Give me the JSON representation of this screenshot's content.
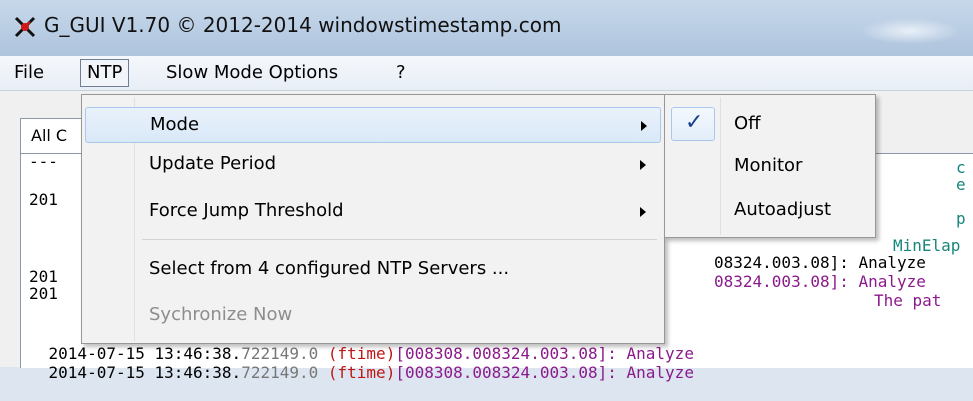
{
  "window": {
    "title": "G_GUI V1.70 © 2012-2014 windowstimestamp.com",
    "icon": "app-logo-icon"
  },
  "menubar": {
    "file": "File",
    "ntp": "NTP",
    "slow_mode": "Slow Mode Options",
    "help": "?"
  },
  "tabs": {
    "active": "All C"
  },
  "log": {
    "dashes": "---",
    "l1": "201",
    "l2": "201",
    "l3": "201",
    "r1": "c",
    "r2": "e",
    "r3": "p",
    "minelap": "MinElap",
    "analyze1": "08324.003.08]: Analyze",
    "analyze2": "08324.003.08]: Analyze",
    "pat": "The pat",
    "row_a_prefix": "2014-07-15 13:46:38.",
    "row_a_time": "722149.0",
    "row_a_ftime": "(ftime)",
    "row_a_rest": "[008308.008324.003.08]: Analyze",
    "row_b_prefix": "2014-07-15 13:46:38.",
    "row_b_time": "722149.0",
    "row_b_ftime": "(ftime)",
    "row_b_rest": "[008308.008324.003.08]: Analyze"
  },
  "ntp_menu": {
    "items": [
      {
        "label": "Mode",
        "submenu": true
      },
      {
        "label": "Update Period",
        "submenu": true
      },
      {
        "label": "Force Jump Threshold",
        "submenu": true
      },
      {
        "label": "Select from 4 configured NTP Servers ...",
        "submenu": false
      },
      {
        "label": "Sychronize Now",
        "submenu": false,
        "disabled": true
      }
    ]
  },
  "mode_submenu": {
    "check_glyph": "✓",
    "items": [
      {
        "label": "Off",
        "checked": true
      },
      {
        "label": "Monitor",
        "checked": false
      },
      {
        "label": "Autoadjust",
        "checked": false
      }
    ]
  },
  "colors": {
    "teal_text": "#17867c",
    "purple_text": "#8b1a8b",
    "red_text": "#c01616",
    "highlight_border": "#a8c8ec"
  }
}
